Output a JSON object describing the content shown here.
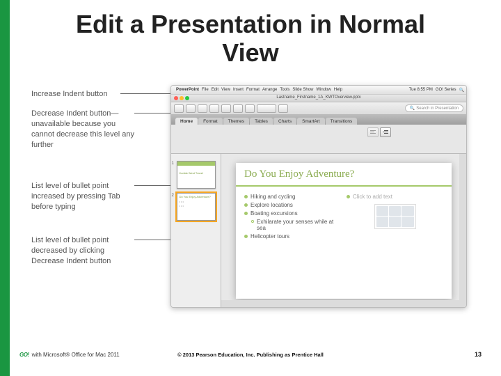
{
  "title": "Edit a Presentation in Normal View",
  "callouts": {
    "increaseIndent": "Increase Indent button",
    "decreaseIndent": "Decrease Indent button—unavailable because you cannot decrease this level any further",
    "listIncreased": "List level of bullet point increased by pressing Tab before typing",
    "listDecreased": "List level of bullet point decreased by clicking Decrease Indent button"
  },
  "menubar": {
    "app": "PowerPoint",
    "items": [
      "File",
      "Edit",
      "View",
      "Insert",
      "Format",
      "Arrange",
      "Tools",
      "Slide Show",
      "Window",
      "Help"
    ],
    "clock": "Tue 8:55 PM",
    "user": "GO! Series"
  },
  "document": "Lastname_Firstname_1A_KWTOverview.pptx",
  "toolbar": {
    "searchPlaceholder": "Search in Presentation"
  },
  "ribbonTabs": [
    "Home",
    "Format",
    "Themes",
    "Tables",
    "Charts",
    "SmartArt",
    "Transitions"
  ],
  "ribbonActive": "Home",
  "thumbnails": [
    {
      "num": "1",
      "title": "Kodiak West Travel"
    },
    {
      "num": "2",
      "title": "Do You Enjoy Adventure?"
    }
  ],
  "slide": {
    "title": "Do You Enjoy Adventure?",
    "leftBullets": [
      {
        "text": "Hiking and cycling",
        "level": 0
      },
      {
        "text": "Explore locations",
        "level": 0
      },
      {
        "text": "Boating excursions",
        "level": 0
      },
      {
        "text": "Exhilarate your senses while at sea",
        "level": 1
      },
      {
        "text": "Helicopter tours",
        "level": 0
      }
    ],
    "rightPlaceholder": "Click to add text"
  },
  "footer": {
    "brand": "GO!",
    "left": "with Microsoft® Office for Mac 2011",
    "center": "© 2013 Pearson Education, Inc. Publishing as Prentice Hall",
    "page": "13"
  }
}
